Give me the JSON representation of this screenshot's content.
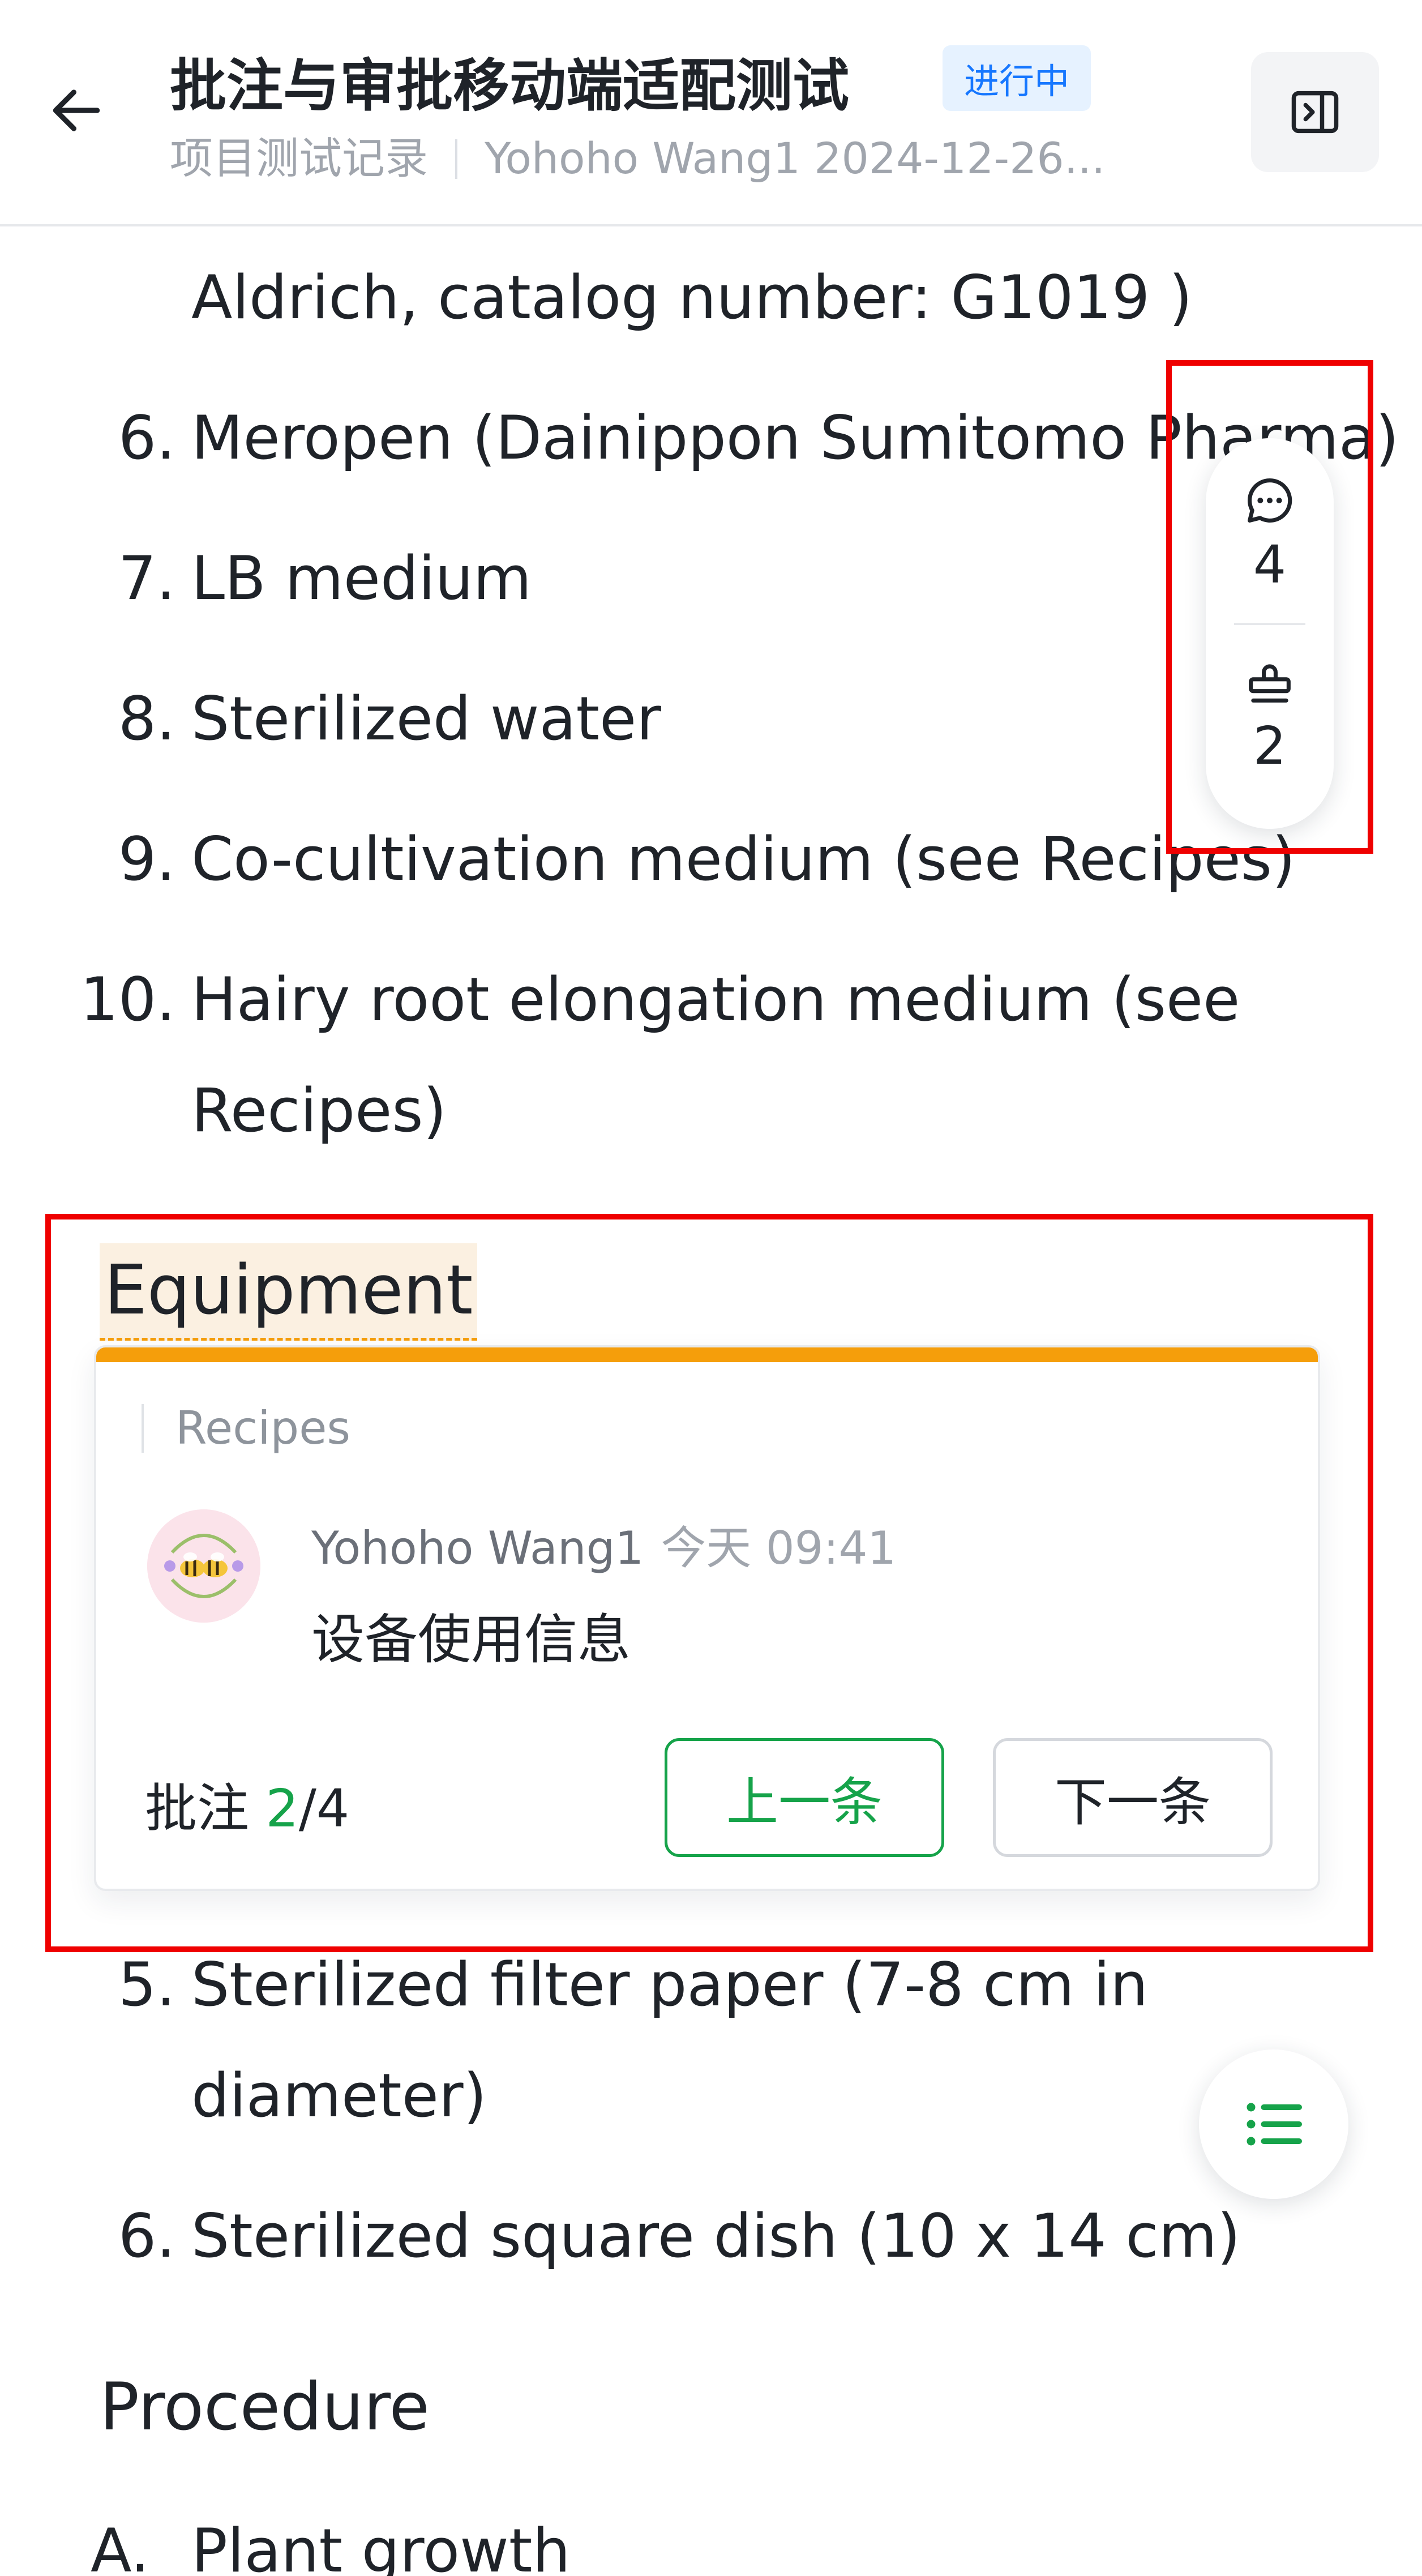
{
  "header": {
    "title": "批注与审批移动端适配测试",
    "status": "进行中",
    "breadcrumb": "项目测试记录",
    "meta": "Yohoho Wang1 2024-12-26..."
  },
  "doc": {
    "line_continuation_1": "Aldrich, catalog number: G1019 )",
    "list_a": [
      {
        "num": "6.",
        "text": "Meropen (Dainippon Sumitomo Pharma)"
      },
      {
        "num": "7.",
        "text": "LB medium"
      },
      {
        "num": "8.",
        "text": "Sterilized water"
      },
      {
        "num": "9.",
        "text": "Co-cultivation medium (see Recipes)"
      },
      {
        "num": "10.",
        "text": "Hairy root elongation medium (see"
      }
    ],
    "list_a_continuation": "Recipes)",
    "heading_equipment": "Equipment",
    "list_b": [
      {
        "num": "5.",
        "text": "Sterilized filter paper (7-8 cm in"
      },
      {
        "num": "6.",
        "text": "Sterilized square dish (10 x 14 cm)"
      }
    ],
    "list_b_continuation": "diameter)",
    "heading_procedure": "Procedure",
    "sub_a_num": "A.",
    "sub_a_text": "Plant growth"
  },
  "annotation": {
    "quote": "Recipes",
    "author": "Yohoho Wang1",
    "time": "今天 09:41",
    "text": "设备使用信息",
    "counter_label": "批注",
    "counter_current": "2",
    "counter_total": "/4",
    "prev_label": "上一条",
    "next_label": "下一条"
  },
  "side_counters": {
    "comments": "4",
    "approvals": "2"
  },
  "colors": {
    "accent_green": "#16a34a",
    "highlight_orange": "#f59e0b",
    "badge_blue": "#1677ff",
    "annotation_box_red": "#ef0000"
  },
  "icons": [
    "back-arrow-icon",
    "panel-toggle-icon",
    "comment-icon",
    "stamp-icon",
    "toc-list-icon",
    "avatar-bees"
  ]
}
